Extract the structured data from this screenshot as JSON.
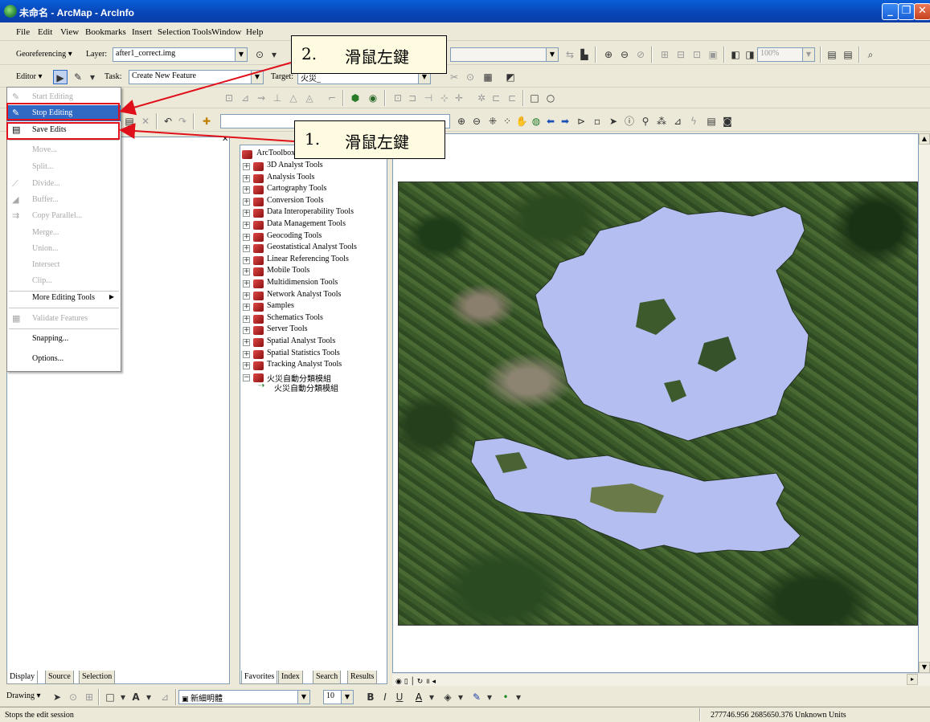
{
  "window": {
    "title": "未命名 - ArcMap - ArcInfo"
  },
  "menubar": {
    "items": [
      {
        "label": "File",
        "u": "F"
      },
      {
        "label": "Edit"
      },
      {
        "label": "View"
      },
      {
        "label": "Bookmarks"
      },
      {
        "label": "Insert"
      },
      {
        "label": "Selection"
      },
      {
        "label": "Tools"
      },
      {
        "label": "Window"
      },
      {
        "label": "Help"
      }
    ]
  },
  "georef_toolbar": {
    "menu": "Georeferencing",
    "layer_label": "Layer:",
    "layer_value": "after1_correct.img"
  },
  "editor_toolbar": {
    "menu": "Editor",
    "task_label": "Task:",
    "task_value": "Create New Feature",
    "target_label": "Target:",
    "target_value": "火災_"
  },
  "std_toolbar": {
    "zoom_value": "100%"
  },
  "editor_menu": {
    "items": [
      {
        "label": "Start Editing",
        "enabled": false,
        "icon": "start-editing-icon"
      },
      {
        "label": "Stop Editing",
        "enabled": true,
        "highlighted": true,
        "icon": "stop-editing-icon"
      },
      {
        "label": "Save Edits",
        "enabled": true,
        "icon": "save-edits-icon"
      },
      {
        "label": "Move...",
        "enabled": false
      },
      {
        "label": "Split...",
        "enabled": false
      },
      {
        "label": "Divide...",
        "enabled": false,
        "icon": "divide-icon"
      },
      {
        "label": "Buffer...",
        "enabled": false,
        "icon": "buffer-icon"
      },
      {
        "label": "Copy Parallel...",
        "enabled": false,
        "icon": "copy-parallel-icon"
      },
      {
        "label": "Merge...",
        "enabled": false
      },
      {
        "label": "Union...",
        "enabled": false
      },
      {
        "label": "Intersect",
        "enabled": false
      },
      {
        "label": "Clip...",
        "enabled": false
      },
      {
        "label": "More Editing Tools",
        "enabled": true,
        "submenu": true
      },
      {
        "label": "Validate Features",
        "enabled": false,
        "icon": "validate-icon"
      },
      {
        "label": "Snapping...",
        "enabled": true
      },
      {
        "label": "Options...",
        "enabled": true
      }
    ]
  },
  "arctoolbox": {
    "root": "ArcToolbox",
    "items": [
      "3D Analyst Tools",
      "Analysis Tools",
      "Cartography Tools",
      "Conversion Tools",
      "Data Interoperability Tools",
      "Data Management Tools",
      "Geocoding Tools",
      "Geostatistical Analyst Tools",
      "Linear Referencing Tools",
      "Mobile Tools",
      "Multidimension Tools",
      "Network Analyst Tools",
      "Samples",
      "Schematics Tools",
      "Server Tools",
      "Spatial Analyst Tools",
      "Spatial Statistics Tools",
      "Tracking Analyst Tools",
      "火災自動分類模組"
    ],
    "model": "火災自動分類模組",
    "tabs": [
      "Favorites",
      "Index",
      "Search",
      "Results"
    ]
  },
  "toc": {
    "tabs": [
      "Display",
      "Source",
      "Selection"
    ]
  },
  "drawing_toolbar": {
    "menu": "Drawing",
    "font": "新細明體",
    "size": "10"
  },
  "callouts": [
    {
      "number": "2.",
      "text": "滑鼠左鍵"
    },
    {
      "number": "1.",
      "text": "滑鼠左鍵"
    }
  ],
  "statusbar": {
    "message": "Stops the edit session",
    "coords": "277746.956  2685650.376 Unknown Units"
  },
  "colors": {
    "highlight": "#316ac5",
    "annotation": "#e0101a",
    "lake": "#b4bef0"
  }
}
